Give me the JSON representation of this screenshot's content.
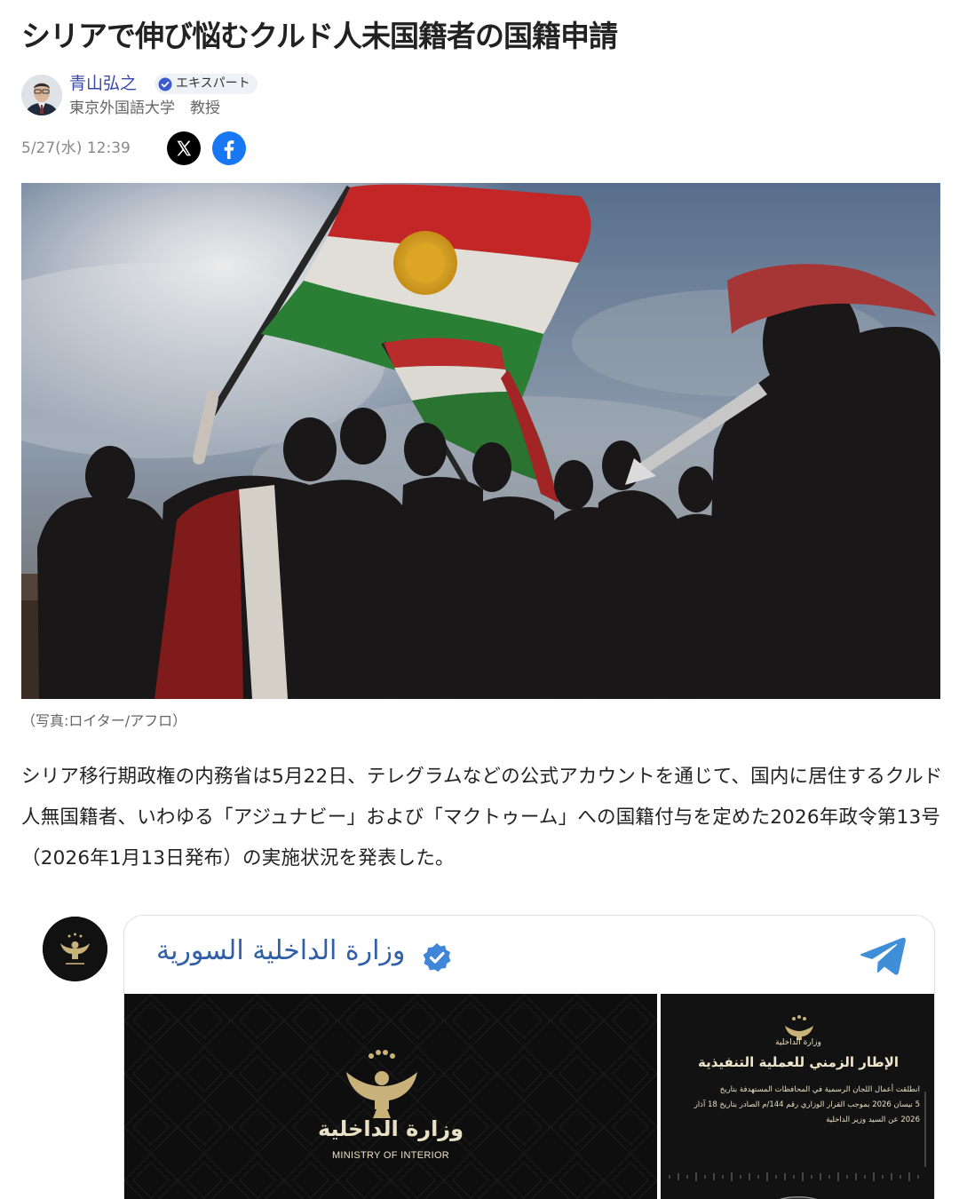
{
  "article": {
    "title": "シリアで伸び悩むクルド人未国籍者の国籍申請",
    "author_name": "青山弘之",
    "badge_label": "エキスパート",
    "author_affiliation": "東京外国語大学　教授",
    "date": "5/27(水) 12:39",
    "photo_caption": "（写真:ロイター/アフロ）",
    "body_paragraph": "シリア移行期政権の内務省は5月22日、テレグラムなどの公式アカウントを通じて、国内に居住するクルド人無国籍者、いわゆる「アジュナビー」および「マクトゥーム」への国籍付与を定めた2026年政令第13号（2026年1月13日発布）の実施状況を発表した。"
  },
  "share": {
    "x_icon": "x-logo-icon",
    "facebook_icon": "facebook-logo-icon"
  },
  "embed": {
    "channel_name": "وزارة الداخلية السورية",
    "image1": {
      "arabic_name": "وزارة الداخلية",
      "english_name": "MINISTRY OF INTERIOR"
    },
    "image2": {
      "small_name": "وزارة الداخلية",
      "headline": "الإطار الزمني للعملية التنفيذية",
      "lines": [
        "انطلقت أعمال اللجان الرسمية في المحافظات المستهدفة بتاريخ",
        "5 نيسان 2026 بموجب القرار الوزاري رقم 144/م الصادر بتاريخ 18 آذار",
        "2026 عن السيد وزير الداخلية"
      ]
    }
  },
  "colors": {
    "author_link": "#3a49a8",
    "channel_blue": "#2e5fa8",
    "facebook": "#1877f2"
  }
}
